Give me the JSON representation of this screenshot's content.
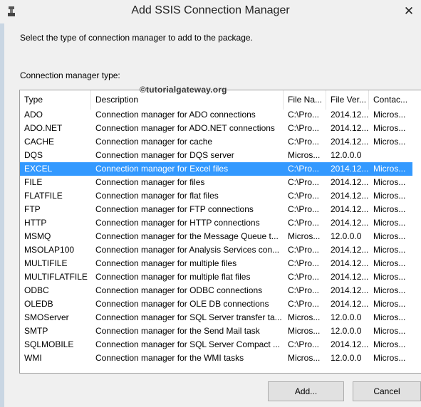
{
  "window": {
    "title": "Add SSIS Connection Manager",
    "close_glyph": "✕"
  },
  "instruction": "Select the type of connection manager to add to the package.",
  "group_label": "Connection manager type:",
  "watermark": "©tutorialgateway.org",
  "list": {
    "columns": [
      "Type",
      "Description",
      "File Na...",
      "File Ver...",
      "Contac..."
    ],
    "selected_index": 4,
    "rows": [
      [
        "ADO",
        "Connection manager for ADO connections",
        "C:\\Pro...",
        "2014.12...",
        "Micros..."
      ],
      [
        "ADO.NET",
        "Connection manager for ADO.NET connections",
        "C:\\Pro...",
        "2014.12...",
        "Micros..."
      ],
      [
        "CACHE",
        "Connection manager for cache",
        "C:\\Pro...",
        "2014.12...",
        "Micros..."
      ],
      [
        "DQS",
        "Connection manager for DQS server",
        "Micros...",
        "12.0.0.0",
        ""
      ],
      [
        "EXCEL",
        "Connection manager for Excel files",
        "C:\\Pro...",
        "2014.12...",
        "Micros..."
      ],
      [
        "FILE",
        "Connection manager for files",
        "C:\\Pro...",
        "2014.12...",
        "Micros..."
      ],
      [
        "FLATFILE",
        "Connection manager for flat files",
        "C:\\Pro...",
        "2014.12...",
        "Micros..."
      ],
      [
        "FTP",
        "Connection manager for FTP connections",
        "C:\\Pro...",
        "2014.12...",
        "Micros..."
      ],
      [
        "HTTP",
        "Connection manager for HTTP connections",
        "C:\\Pro...",
        "2014.12...",
        "Micros..."
      ],
      [
        "MSMQ",
        "Connection manager for the Message Queue t...",
        "Micros...",
        "12.0.0.0",
        "Micros..."
      ],
      [
        "MSOLAP100",
        "Connection manager for Analysis Services con...",
        "C:\\Pro...",
        "2014.12...",
        "Micros..."
      ],
      [
        "MULTIFILE",
        "Connection manager for multiple files",
        "C:\\Pro...",
        "2014.12...",
        "Micros..."
      ],
      [
        "MULTIFLATFILE",
        "Connection manager for multiple flat files",
        "C:\\Pro...",
        "2014.12...",
        "Micros..."
      ],
      [
        "ODBC",
        "Connection manager for ODBC connections",
        "C:\\Pro...",
        "2014.12...",
        "Micros..."
      ],
      [
        "OLEDB",
        "Connection manager for OLE DB connections",
        "C:\\Pro...",
        "2014.12...",
        "Micros..."
      ],
      [
        "SMOServer",
        "Connection manager for SQL Server transfer ta...",
        "Micros...",
        "12.0.0.0",
        "Micros..."
      ],
      [
        "SMTP",
        "Connection manager for the Send Mail task",
        "Micros...",
        "12.0.0.0",
        "Micros..."
      ],
      [
        "SQLMOBILE",
        "Connection manager for SQL Server Compact ...",
        "C:\\Pro...",
        "2014.12...",
        "Micros..."
      ],
      [
        "WMI",
        "Connection manager for the WMI tasks",
        "Micros...",
        "12.0.0.0",
        "Micros..."
      ]
    ]
  },
  "buttons": {
    "add": "Add...",
    "cancel": "Cancel"
  },
  "colors": {
    "selection": "#3399ff",
    "window_bg": "#f0f0f0"
  }
}
